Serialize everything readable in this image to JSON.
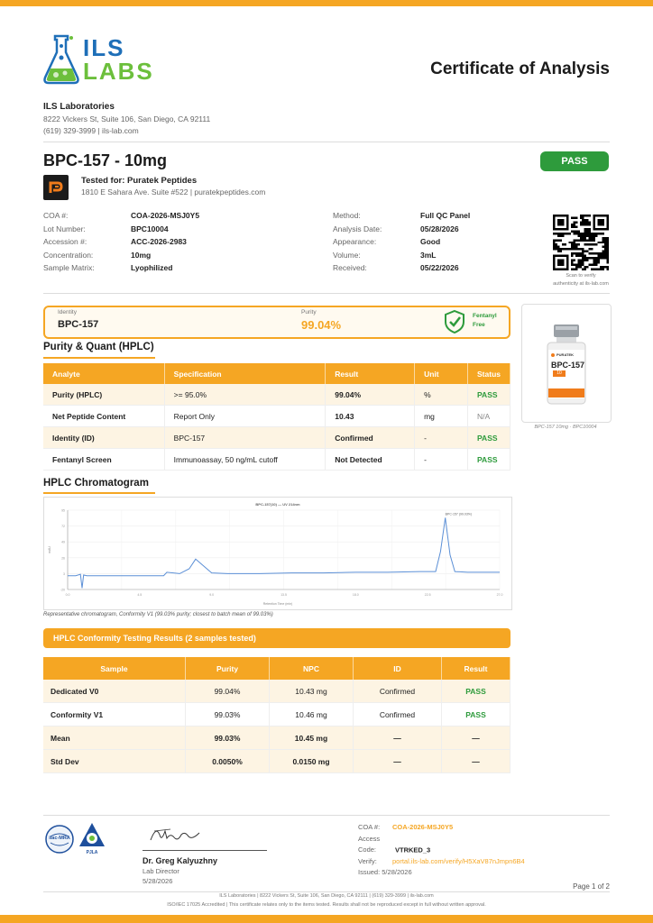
{
  "logo": {
    "top": "ILS",
    "bottom": "LABS"
  },
  "doc_title": "Certificate of Analysis",
  "lab": {
    "name": "ILS Laboratories",
    "address": "8222 Vickers St, Suite 106, San Diego, CA 92111",
    "contact": "(619) 329-3999  |  ils-lab.com"
  },
  "product": {
    "title": "BPC-157 - 10mg",
    "tested_for": "Tested for: Puratek Peptides",
    "client_address": "1810 E Sahara Ave. Suite #522  |  puratekpeptides.com",
    "status": "PASS"
  },
  "info_left": [
    {
      "label": "COA #:",
      "value": "COA-2026-MSJ0Y5"
    },
    {
      "label": "Lot Number:",
      "value": "BPC10004"
    },
    {
      "label": "Accession #:",
      "value": "ACC-2026-2983"
    },
    {
      "label": "Concentration:",
      "value": "10mg"
    },
    {
      "label": "Sample Matrix:",
      "value": "Lyophilized"
    }
  ],
  "info_right": [
    {
      "label": "Method:",
      "value": "Full QC Panel"
    },
    {
      "label": "Analysis Date:",
      "value": "05/28/2026"
    },
    {
      "label": "Appearance:",
      "value": "Good"
    },
    {
      "label": "Volume:",
      "value": "3mL"
    },
    {
      "label": "Received:",
      "value": "05/22/2026"
    }
  ],
  "qr": {
    "caption1": "Scan to verify",
    "caption2": "authenticity at ils-lab.com"
  },
  "summary": {
    "identity_label": "Identity",
    "identity_value": "BPC-157",
    "purity_label": "Purity",
    "purity_value": "99.04%",
    "badge_line1": "Fentanyl",
    "badge_line2": "Free"
  },
  "vial": {
    "brand": "PURATEK",
    "name": "BPC-157",
    "dose": "10",
    "caption": "BPC-157 10mg · BPC10004"
  },
  "purity_section": {
    "title": "Purity & Quant (HPLC)",
    "headers": [
      "Analyte",
      "Specification",
      "Result",
      "Unit",
      "Status"
    ],
    "rows": [
      {
        "analyte": "Purity (HPLC)",
        "spec": ">= 95.0%",
        "result": "99.04%",
        "unit": "%",
        "status": "PASS"
      },
      {
        "analyte": "Net Peptide Content",
        "spec": "Report Only",
        "result": "10.43",
        "unit": "mg",
        "status": "N/A"
      },
      {
        "analyte": "Identity (ID)",
        "spec": "BPC-157",
        "result": "Confirmed",
        "unit": "-",
        "status": "PASS"
      },
      {
        "analyte": "Fentanyl Screen",
        "spec": "Immunoassay, 50 ng/mL cutoff",
        "result": "Not Detected",
        "unit": "-",
        "status": "PASS"
      }
    ]
  },
  "chromatogram": {
    "title": "HPLC Chromatogram",
    "caption": "Representative chromatogram, Conformity V1 (99.03% purity; closest to batch mean of 99.03%)"
  },
  "chart_data": {
    "type": "line",
    "title": "BPC-157(10) — UV 214nm",
    "xlabel": "Retention Time (min)",
    "ylabel": "mAU",
    "peak_label": "BPC-157 (99.03%)",
    "x": [
      0.0,
      0.5,
      0.8,
      0.9,
      1.0,
      1.2,
      3.0,
      6.0,
      6.2,
      7.0,
      7.6,
      8.0,
      8.6,
      9.0,
      10.0,
      12.0,
      14.0,
      16.0,
      18.0,
      20.0,
      22.0,
      23.0,
      23.3,
      23.6,
      23.9,
      24.2,
      25.0,
      27.0
    ],
    "y": [
      0,
      0,
      2,
      -18,
      1,
      0,
      0,
      0,
      5,
      3,
      10,
      24,
      12,
      4,
      3,
      3,
      4,
      4,
      5,
      5,
      6,
      6,
      35,
      84,
      30,
      6,
      5,
      5
    ],
    "xlim": [
      0,
      27
    ],
    "ylim": [
      -20,
      95
    ]
  },
  "conformity": {
    "title": "HPLC Conformity Testing Results (2 samples tested)",
    "headers": [
      "Sample",
      "Purity",
      "NPC",
      "ID",
      "Result"
    ],
    "rows": [
      {
        "sample": "Dedicated V0",
        "purity": "99.04%",
        "npc": "10.43 mg",
        "id": "Confirmed",
        "result": "PASS"
      },
      {
        "sample": "Conformity V1",
        "purity": "99.03%",
        "npc": "10.46 mg",
        "id": "Confirmed",
        "result": "PASS"
      },
      {
        "sample": "Mean",
        "purity": "99.03%",
        "npc": "10.45 mg",
        "id": "—",
        "result": "—"
      },
      {
        "sample": "Std Dev",
        "purity": "0.0050%",
        "npc": "0.0150 mg",
        "id": "—",
        "result": "—"
      }
    ]
  },
  "seals": {
    "ilac": "ilac-MRA",
    "pjla": "PJLA"
  },
  "signer": {
    "name": "Dr. Greg Kalyuzhny",
    "role": "Lab Director",
    "date": "5/28/2026"
  },
  "verify": {
    "coa_label": "COA #:",
    "coa_value": "COA-2026-MSJ0Y5",
    "access_label": "Access Code:",
    "access_value": "VTRKED_3",
    "verify_label": "Verify:",
    "verify_value": "portal.ils-lab.com/verify/H5XaV87nJmpn6B4",
    "issued": "Issued: 5/28/2026"
  },
  "page_num": "Page 1 of 2",
  "footer": {
    "line1": "ILS Laboratories  |  8222 Vickers St, Suite 106, San Diego, CA 92111  |  (619) 329-3999  |  ils-lab.com",
    "line2": "ISO/IEC 17025 Accredited  |  This certificate relates only to the items tested. Results shall not be reproduced except in full without written approval."
  },
  "colors": {
    "accent": "#f5a623",
    "pass": "#2e9b3c",
    "logo_blue": "#1e6fb8",
    "logo_green": "#6cbf3c"
  }
}
